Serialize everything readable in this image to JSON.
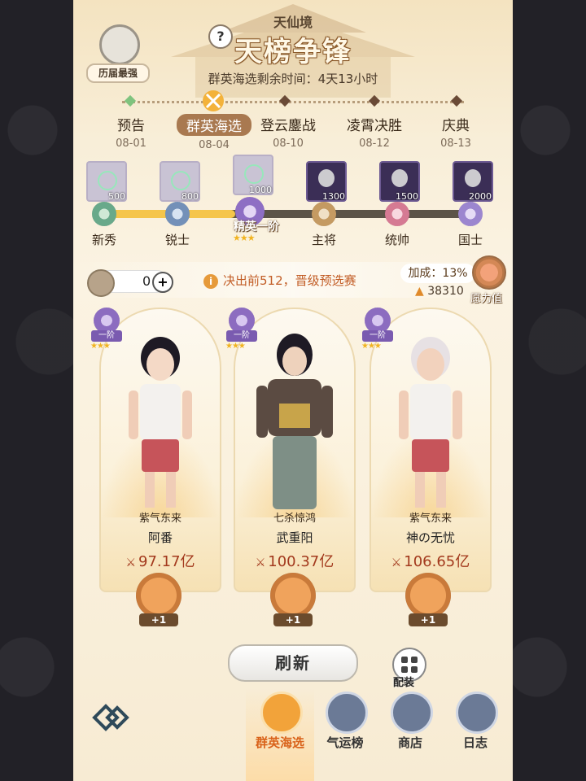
{
  "header": {
    "realm": "天仙境",
    "title": "天榜争锋",
    "timer": "群英海选剩余时间：4天13小时",
    "help_glyph": "?",
    "hall_of_fame": "历届最强"
  },
  "stages": [
    {
      "name": "预告",
      "date": "08-01"
    },
    {
      "name": "群英海选",
      "date": "08-04",
      "active": true
    },
    {
      "name": "登云鏖战",
      "date": "08-10"
    },
    {
      "name": "凌霄决胜",
      "date": "08-12"
    },
    {
      "name": "庆典",
      "date": "08-13"
    }
  ],
  "reward_track": {
    "chests": [
      {
        "value": "500",
        "state": "claimed"
      },
      {
        "value": "800",
        "state": "claimed"
      },
      {
        "value": "1000",
        "state": "claimed"
      },
      {
        "value": "1300",
        "state": "locked"
      },
      {
        "value": "1500",
        "state": "locked"
      },
      {
        "value": "2000",
        "state": "locked"
      }
    ],
    "ranks": [
      "新秀",
      "锐士",
      "精英一阶",
      "主将",
      "统帅",
      "国士"
    ],
    "current_rank": "精英一阶",
    "current_stars": "★★★",
    "progress_fraction": 0.36
  },
  "info": {
    "tokens": "0",
    "plus": "+",
    "notice_icon": "i",
    "notice": "决出前512，晋级预选赛",
    "bonus": "加成：13%",
    "power": "38310",
    "wish_label": "愿力值"
  },
  "opponents": [
    {
      "tier": "一阶",
      "stars": "★★★",
      "guild": "紫气东来",
      "name": "阿番",
      "power": "97.17亿",
      "attack_bonus": "+1"
    },
    {
      "tier": "一阶",
      "stars": "★★★",
      "guild": "七杀惊鸿",
      "name": "武重阳",
      "power": "100.37亿",
      "attack_bonus": "+1"
    },
    {
      "tier": "一阶",
      "stars": "★★★",
      "guild": "紫气东来",
      "name": "神の无忧",
      "power": "106.65亿",
      "attack_bonus": "+1"
    }
  ],
  "actions": {
    "refresh": "刷新",
    "equip": "配装"
  },
  "nav": [
    {
      "label": "群英海选",
      "icon": "trophy-icon",
      "active": true
    },
    {
      "label": "气运榜",
      "icon": "fortune-icon"
    },
    {
      "label": "商店",
      "icon": "shop-icon"
    },
    {
      "label": "日志",
      "icon": "log-icon"
    }
  ],
  "colors": {
    "accent": "#d9621a",
    "power_red": "#a3391d",
    "gold": "#f5c54b"
  }
}
